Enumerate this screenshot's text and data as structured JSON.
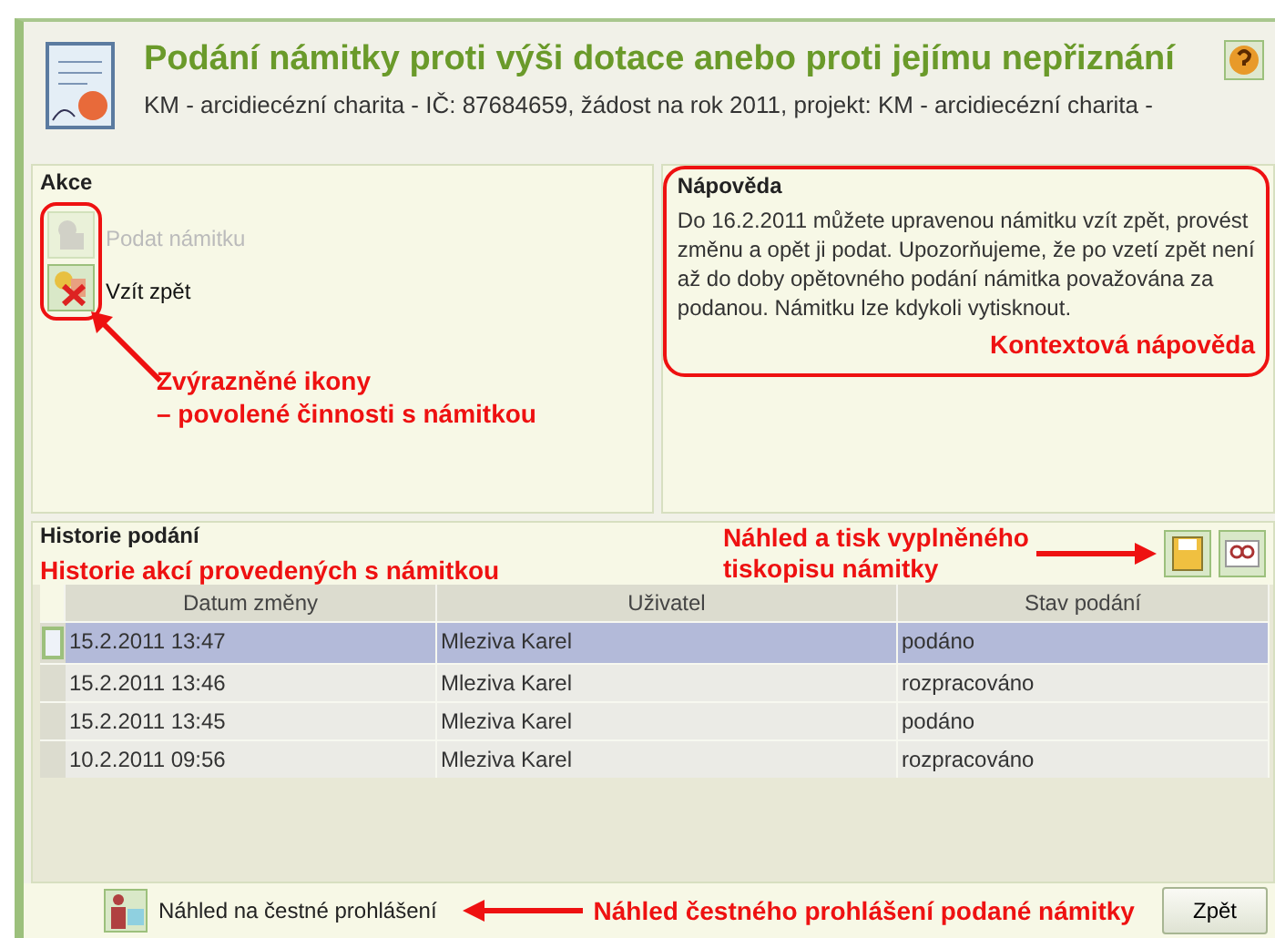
{
  "header": {
    "title": "Podání námitky proti výši dotace anebo proti jejímu nepřiznání",
    "subtitle": "KM - arcidiecézní charita - IČ: 87684659, žádost na rok 2011, projekt: KM - arcidiecézní charita -"
  },
  "actions": {
    "legend": "Akce",
    "items": [
      {
        "label": "Podat námitku",
        "disabled": true
      },
      {
        "label": "Vzít zpět",
        "disabled": false
      }
    ],
    "annotation": [
      "Zvýrazněné ikony",
      "– povolené činnosti s námitkou"
    ]
  },
  "help": {
    "legend": "Nápověda",
    "text": "Do 16.2.2011 můžete upravenou námitku vzít zpět, provést změnu a opět ji podat. Upozorňujeme, že po vzetí zpět není až do doby opětovného podání námitka považována za podanou. Námitku lze kdykoli vytisknout.",
    "annotation": "Kontextová nápověda"
  },
  "history": {
    "legend": "Historie podání",
    "annotation": "Historie akcí provedených s námitkou",
    "print_annotation": [
      "Náhled a tisk vyplněného",
      "tiskopisu námitky"
    ],
    "columns": [
      "Datum změny",
      "Uživatel",
      "Stav podání"
    ],
    "rows": [
      {
        "cells": [
          "15.2.2011 13:47",
          "Mleziva Karel",
          "podáno"
        ],
        "selected": true
      },
      {
        "cells": [
          "15.2.2011 13:46",
          "Mleziva Karel",
          "rozpracováno"
        ],
        "selected": false
      },
      {
        "cells": [
          "15.2.2011 13:45",
          "Mleziva Karel",
          "podáno"
        ],
        "selected": false
      },
      {
        "cells": [
          "10.2.2011 09:56",
          "Mleziva Karel",
          "rozpracováno"
        ],
        "selected": false
      }
    ]
  },
  "footer": {
    "link": "Náhled na čestné prohlášení",
    "annotation": "Náhled čestného prohlášení podané námitky",
    "back_button": "Zpět"
  }
}
